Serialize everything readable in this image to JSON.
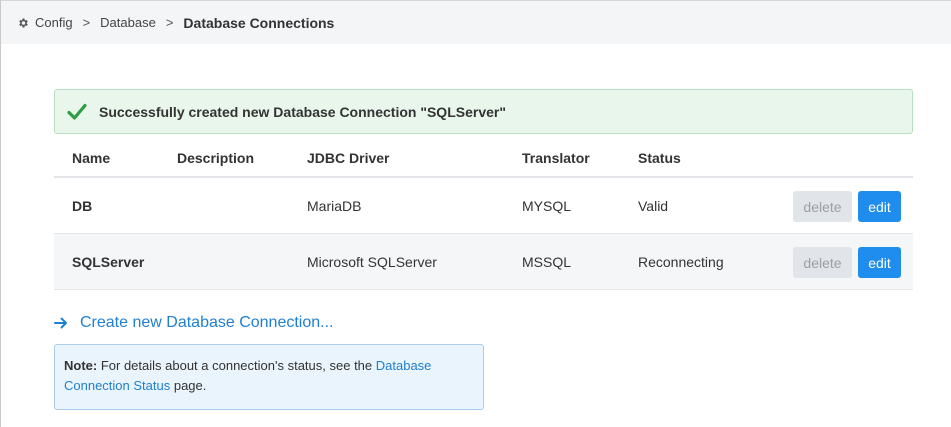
{
  "breadcrumb": {
    "items": [
      "Config",
      "Database"
    ],
    "separator": ">",
    "current": "Database Connections"
  },
  "alert": {
    "message": "Successfully created new Database Connection \"SQLServer\"",
    "icon": "check-icon",
    "color": "#2e9e45"
  },
  "table": {
    "headers": {
      "name": "Name",
      "description": "Description",
      "jdbc_driver": "JDBC Driver",
      "translator": "Translator",
      "status": "Status"
    },
    "rows": [
      {
        "name": "DB",
        "description": "",
        "jdbc_driver": "MariaDB",
        "translator": "MYSQL",
        "status": "Valid",
        "delete_label": "delete",
        "edit_label": "edit"
      },
      {
        "name": "SQLServer",
        "description": "",
        "jdbc_driver": "Microsoft SQLServer",
        "translator": "MSSQL",
        "status": "Reconnecting",
        "delete_label": "delete",
        "edit_label": "edit"
      }
    ]
  },
  "create_link": {
    "label": "Create new Database Connection...",
    "icon": "arrow-right-icon"
  },
  "note": {
    "label": "Note:",
    "text_before": " For details about a connection's status, see the ",
    "link_text": "Database Connection Status",
    "text_after": " page."
  },
  "colors": {
    "accent": "#1f8ded",
    "link": "#1f7fd0",
    "success_bg": "#e9f6ec",
    "note_bg": "#eaf4fc"
  }
}
